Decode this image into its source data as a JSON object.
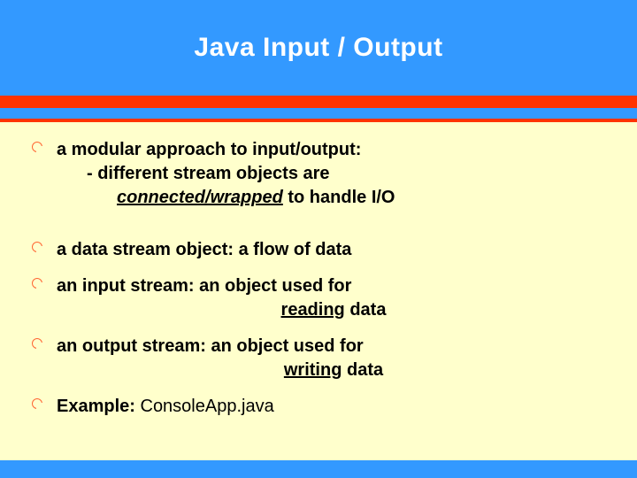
{
  "title": "Java Input / Output",
  "bullets": {
    "b1": {
      "line1": "a modular approach to input/output:",
      "line2_pre": "- different stream objects  are",
      "line3_em": "connected/wrapped",
      "line3_rest": " to handle I/O"
    },
    "b2": "a data stream object: a flow of data",
    "b3": {
      "line1": "an input stream: an object used for",
      "key": "reading",
      "rest": " data"
    },
    "b4": {
      "line1": "an output stream: an object used for",
      "key": "writing",
      "rest": " data"
    },
    "b5": {
      "label": "Example:",
      "value": " ConsoleApp.java"
    }
  }
}
